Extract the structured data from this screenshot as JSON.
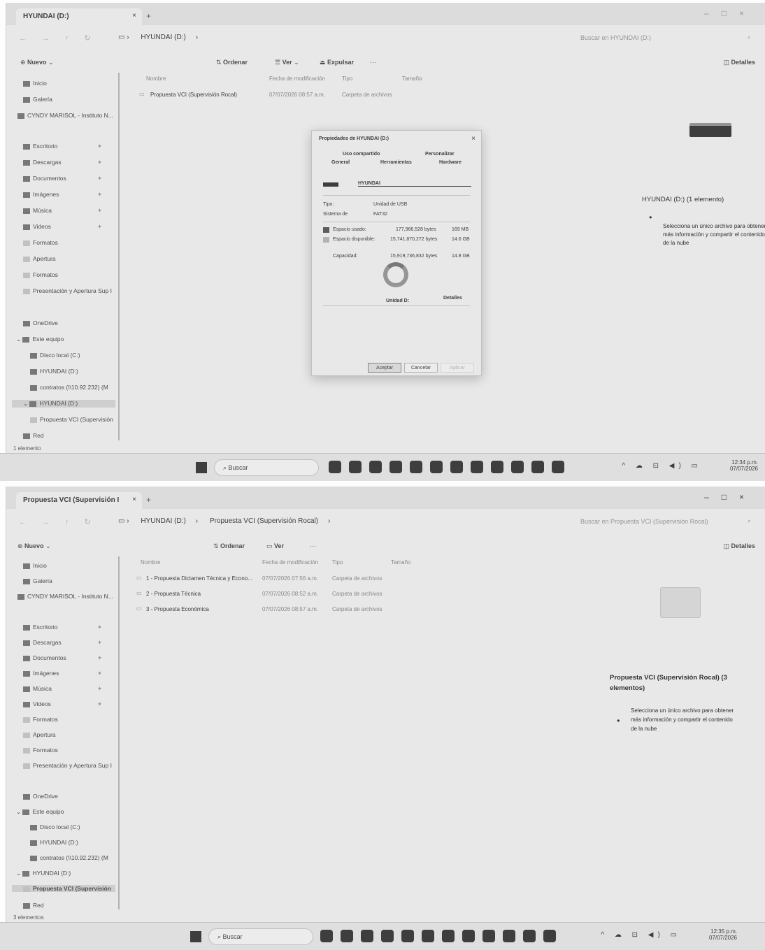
{
  "screen1": {
    "tab": {
      "title": "HYUNDAI (D:)"
    },
    "breadcrumb": [
      "HYUNDAI (D:)"
    ],
    "search_placeholder": "Buscar en HYUNDAI (D:)",
    "toolbar": {
      "new": "Nuevo",
      "sort": "Ordenar",
      "view": "Ver",
      "eject": "Expulsar",
      "more": "···",
      "details": "Detalles"
    },
    "nav": {
      "home": "Inicio",
      "gallery": "Galería",
      "user": "CYNDY MARISOL - Instituto N...",
      "desktop": "Escritorio",
      "downloads": "Descargas",
      "documents": "Documentos",
      "images": "Imágenes",
      "music": "Música",
      "videos": "Videos",
      "f1": "Formatos",
      "f2": "Apertura",
      "f3": "Formatos",
      "f4": "Presentación y Apertura Sup I",
      "onedrive": "OneDrive",
      "thispc": "Este equipo",
      "localdisk": "Disco local (C:)",
      "hyundai": "HYUNDAI (D:)",
      "contratos": "contratos (\\\\10.92.232) (M",
      "hyundai2": "HYUNDAI (D:)",
      "propuesta": "Propuesta VCI (Supervisión",
      "network": "Red"
    },
    "columns": [
      "Nombre",
      "Fecha de modificación",
      "Tipo",
      "Tamaño"
    ],
    "rows": [
      {
        "name": "Propuesta VCI (Supervisión Rocal)",
        "date": "07/07/2026 08:57 a.m.",
        "type": "Carpeta de archivos"
      }
    ],
    "details": {
      "title": "HYUNDAI (D:) (1 elemento)",
      "hint": "Selecciona un único archivo para obtener más información y compartir el contenido de la nube"
    },
    "status": "1 elemento",
    "dialog": {
      "title": "Propiedades de HYUNDAI (D:)",
      "tabs_row1": [
        "Uso compartido",
        "Personalizar"
      ],
      "tabs_row2": [
        "General",
        "Herramientas",
        "Hardware"
      ],
      "name": "HYUNDAI",
      "type_label": "Tipo:",
      "type_value": "Unidad de USB",
      "fs_label": "Sistema de",
      "fs_value": "FAT32",
      "used_label": "Espacio usado:",
      "used_bytes": "177,966,528 bytes",
      "used_size": "169 MB",
      "free_label": "Espacio disponible:",
      "free_bytes": "15,741,870,272 bytes",
      "free_size": "14.6 GB",
      "cap_label": "Capacidad:",
      "cap_bytes": "15,919,736,832 bytes",
      "cap_size": "14.8 GB",
      "drive_label": "Unidad D:",
      "details_btn": "Detalles",
      "ok": "Aceptar",
      "cancel": "Cancelar",
      "apply": "Aplicar"
    },
    "taskbar": {
      "search": "Buscar",
      "time": "12:34 p.m.",
      "date": "07/07/2026"
    }
  },
  "screen2": {
    "tab": {
      "title": "Propuesta VCI (Supervisión I"
    },
    "breadcrumb": [
      "HYUNDAI (D:)",
      "Propuesta VCI (Supervisión Rocal)"
    ],
    "search_placeholder": "Buscar en Propuesta VCI (Supervisión Rocal)",
    "toolbar": {
      "new": "Nuevo",
      "sort": "Ordenar",
      "view": "Ver",
      "more": "···",
      "details": "Detalles"
    },
    "columns": [
      "Nombre",
      "Fecha de modificación",
      "Tipo",
      "Tamaño"
    ],
    "rows": [
      {
        "name": "1 - Propuesta Dictamen Técnica y Econo...",
        "date": "07/07/2026 07:56 a.m.",
        "type": "Carpeta de archivos"
      },
      {
        "name": "2 - Propuesta Técnica",
        "date": "07/07/2026 08:52 a.m.",
        "type": "Carpeta de archivos"
      },
      {
        "name": "3 - Propuesta Económica",
        "date": "07/07/2026 08:57 a.m.",
        "type": "Carpeta de archivos"
      }
    ],
    "details": {
      "title": "Propuesta VCI (Supervisión Rocal) (3 elementos)",
      "hint": "Selecciona un único archivo para obtener más información y compartir el contenido de la nube"
    },
    "status": "3 elementos",
    "taskbar": {
      "search": "Buscar",
      "time": "12:35 p.m.",
      "date": "07/07/2026"
    }
  }
}
